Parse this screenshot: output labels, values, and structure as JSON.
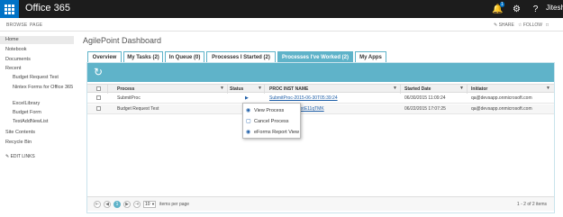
{
  "topbar": {
    "brand": "Office 365",
    "notification_count": "1",
    "user": "Jitesh"
  },
  "ribbon": {
    "tabs": [
      "BROWSE",
      "PAGE"
    ],
    "share": "SHARE",
    "follow": "FOLLOW"
  },
  "nav": {
    "home": "Home",
    "notebook": "Notebook",
    "documents": "Documents",
    "recent": "Recent",
    "recent_items": [
      "Budget Request Test",
      "Nintex Forms for Office 365",
      "ExcelLibrary",
      "Budget Form",
      "TestAddNewList"
    ],
    "site_contents": "Site Contents",
    "recycle_bin": "Recycle Bin",
    "edit_links": "EDIT LINKS"
  },
  "page": {
    "title": "AgilePoint Dashboard"
  },
  "tabs": [
    {
      "label": "Overview"
    },
    {
      "label": "My Tasks (2)"
    },
    {
      "label": "In Queue (0)"
    },
    {
      "label": "Processes I Started (2)"
    },
    {
      "label": "Processes I've Worked (2)"
    },
    {
      "label": "My Apps"
    }
  ],
  "grid": {
    "headers": [
      "Process",
      "Status",
      "PROC INST NAME",
      "Started Date",
      "Initiator"
    ],
    "rows": [
      {
        "process": "SubmitProc",
        "inst": "SubmitProc-2015-06-30T05:39:24",
        "date": "06/30/2015 11:09:24",
        "initiator": "qa@devsapp.onmicrosoft.com"
      },
      {
        "process": "Budget Request Test",
        "inst": "yphKEXYAZE5txtE11qTMK",
        "date": "06/22/2015 17:07:25",
        "initiator": "qa@devsapp.onmicrosoft.com"
      }
    ]
  },
  "context_menu": [
    "View Process",
    "Cancel Process",
    "eForms Report View"
  ],
  "pager": {
    "current_page": "1",
    "page_size": "10",
    "items_per_page_label": "items per page",
    "count": "1 - 2 of 2 items"
  },
  "colors": {
    "accent": "#5fb3c9",
    "topbar": "#1c1c1c",
    "waffle": "#0072c6"
  }
}
